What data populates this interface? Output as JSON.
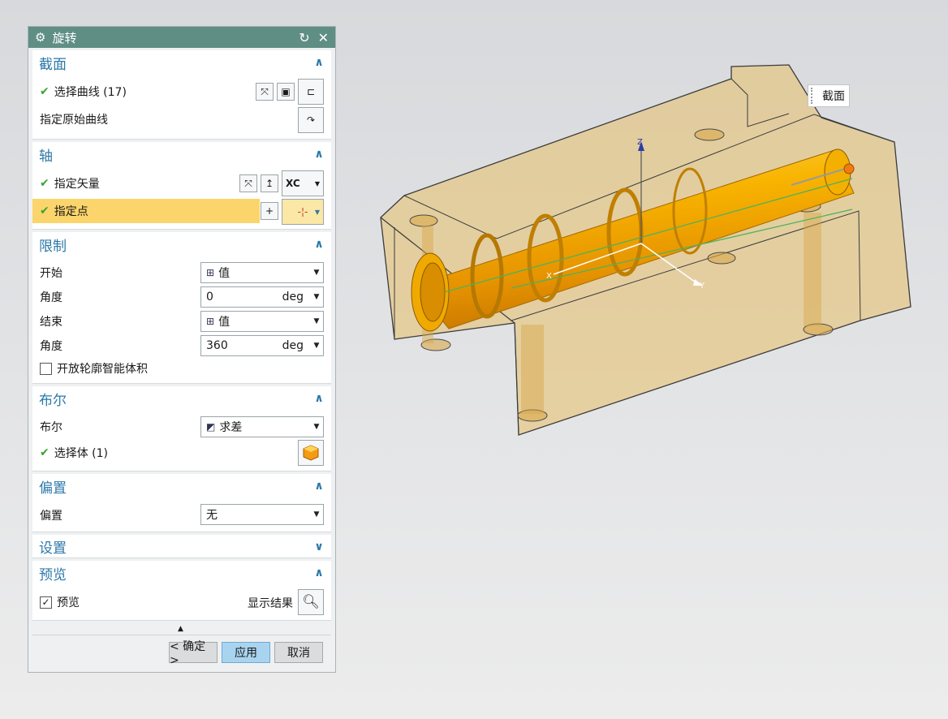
{
  "dialog": {
    "title": "旋转",
    "icons": {
      "title": "gear-icon",
      "reset": "reset-icon",
      "close": "close-icon"
    }
  },
  "section": {
    "title": "截面",
    "select_curve": "选择曲线 (17)",
    "origin_curve": "指定原始曲线"
  },
  "axis": {
    "title": "轴",
    "vector": "指定矢量",
    "vector_value": "XC",
    "point": "指定点"
  },
  "limits": {
    "title": "限制",
    "start_label": "开始",
    "start_value": "值",
    "start_angle_label": "角度",
    "start_angle": "0",
    "end_label": "结束",
    "end_value": "值",
    "end_angle_label": "角度",
    "end_angle": "360",
    "unit": "deg",
    "open_profile": "开放轮廓智能体积"
  },
  "boolean": {
    "title": "布尔",
    "label": "布尔",
    "value": "求差",
    "select_body": "选择体 (1)"
  },
  "offset": {
    "title": "偏置",
    "label": "偏置",
    "value": "无"
  },
  "settings": {
    "title": "设置"
  },
  "preview": {
    "title": "预览",
    "checkbox_label": "预览",
    "show_result": "显示结果"
  },
  "buttons": {
    "ok": "< 确定 >",
    "apply": "应用",
    "cancel": "取消"
  },
  "viewport": {
    "tooltip": "截面",
    "axis_labels": {
      "z": "Z",
      "x": "X",
      "y": "Y"
    }
  },
  "colors": {
    "title_bar": "#5f8e84",
    "section_title": "#2c78a8",
    "highlight": "#fbd56b",
    "apply_button": "#a9d4f0",
    "part_orange": "#f5a800",
    "block_tan": "#e5bb63"
  }
}
